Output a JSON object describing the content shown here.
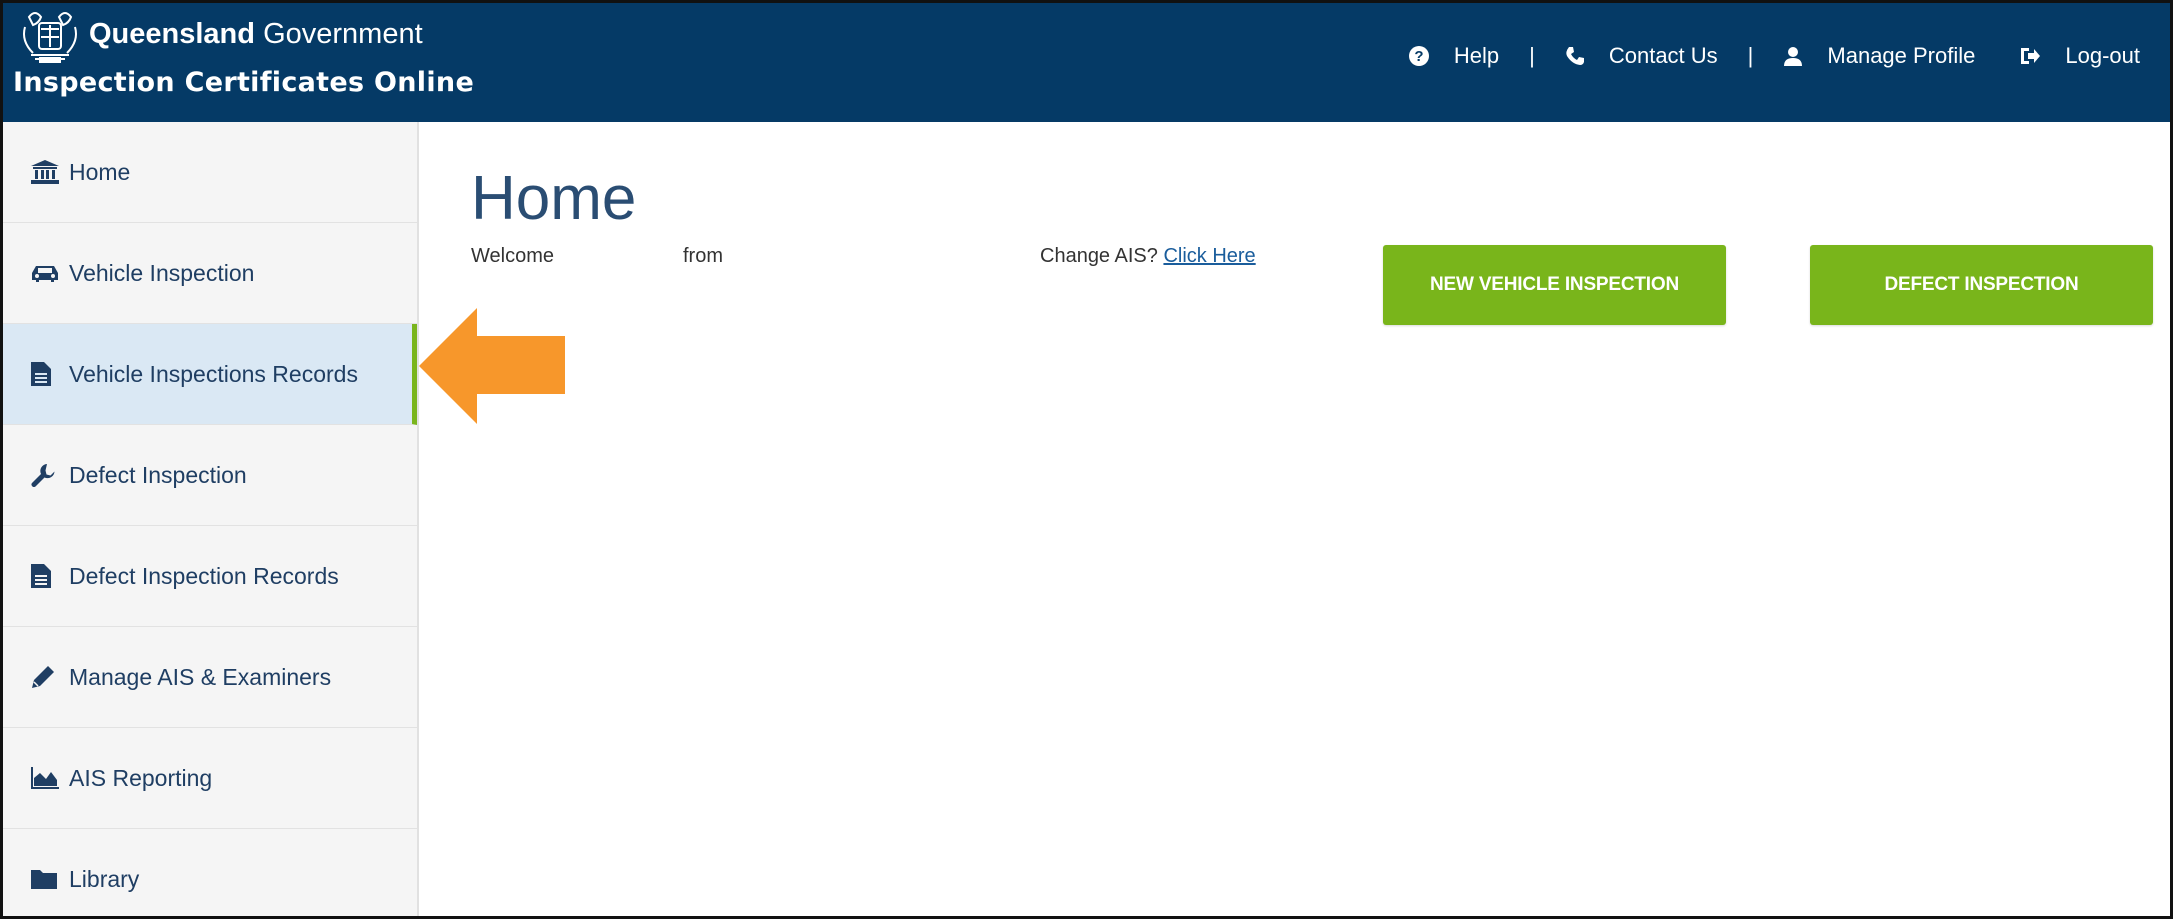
{
  "header": {
    "brand_top_bold": "Queensland",
    "brand_top_regular": "Government",
    "app_title": "Inspection Certificates Online",
    "nav": {
      "help": "Help",
      "separator": "|",
      "contact": "Contact Us",
      "manage_profile": "Manage Profile",
      "logout": "Log-out"
    }
  },
  "sidebar": {
    "items": [
      {
        "label": "Home",
        "icon": "bank-icon"
      },
      {
        "label": "Vehicle Inspection",
        "icon": "car-icon"
      },
      {
        "label": "Vehicle Inspections Records",
        "icon": "document-icon",
        "active": true
      },
      {
        "label": "Defect Inspection",
        "icon": "wrench-icon"
      },
      {
        "label": "Defect Inspection Records",
        "icon": "document-icon"
      },
      {
        "label": "Manage AIS & Examiners",
        "icon": "pencil-icon"
      },
      {
        "label": "AIS Reporting",
        "icon": "area-chart-icon"
      },
      {
        "label": "Library",
        "icon": "folder-icon"
      }
    ]
  },
  "main": {
    "title": "Home",
    "welcome": "Welcome",
    "from": "from",
    "change_ais": "Change AIS?",
    "click_here": "Click Here",
    "buttons": {
      "new_vehicle_inspection": "NEW VEHICLE INSPECTION",
      "defect_inspection": "DEFECT INSPECTION"
    }
  },
  "colors": {
    "header_bg": "#053a66",
    "accent_green": "#79b51b",
    "active_bg": "#dae8f4",
    "annotation_arrow": "#f7972b"
  }
}
